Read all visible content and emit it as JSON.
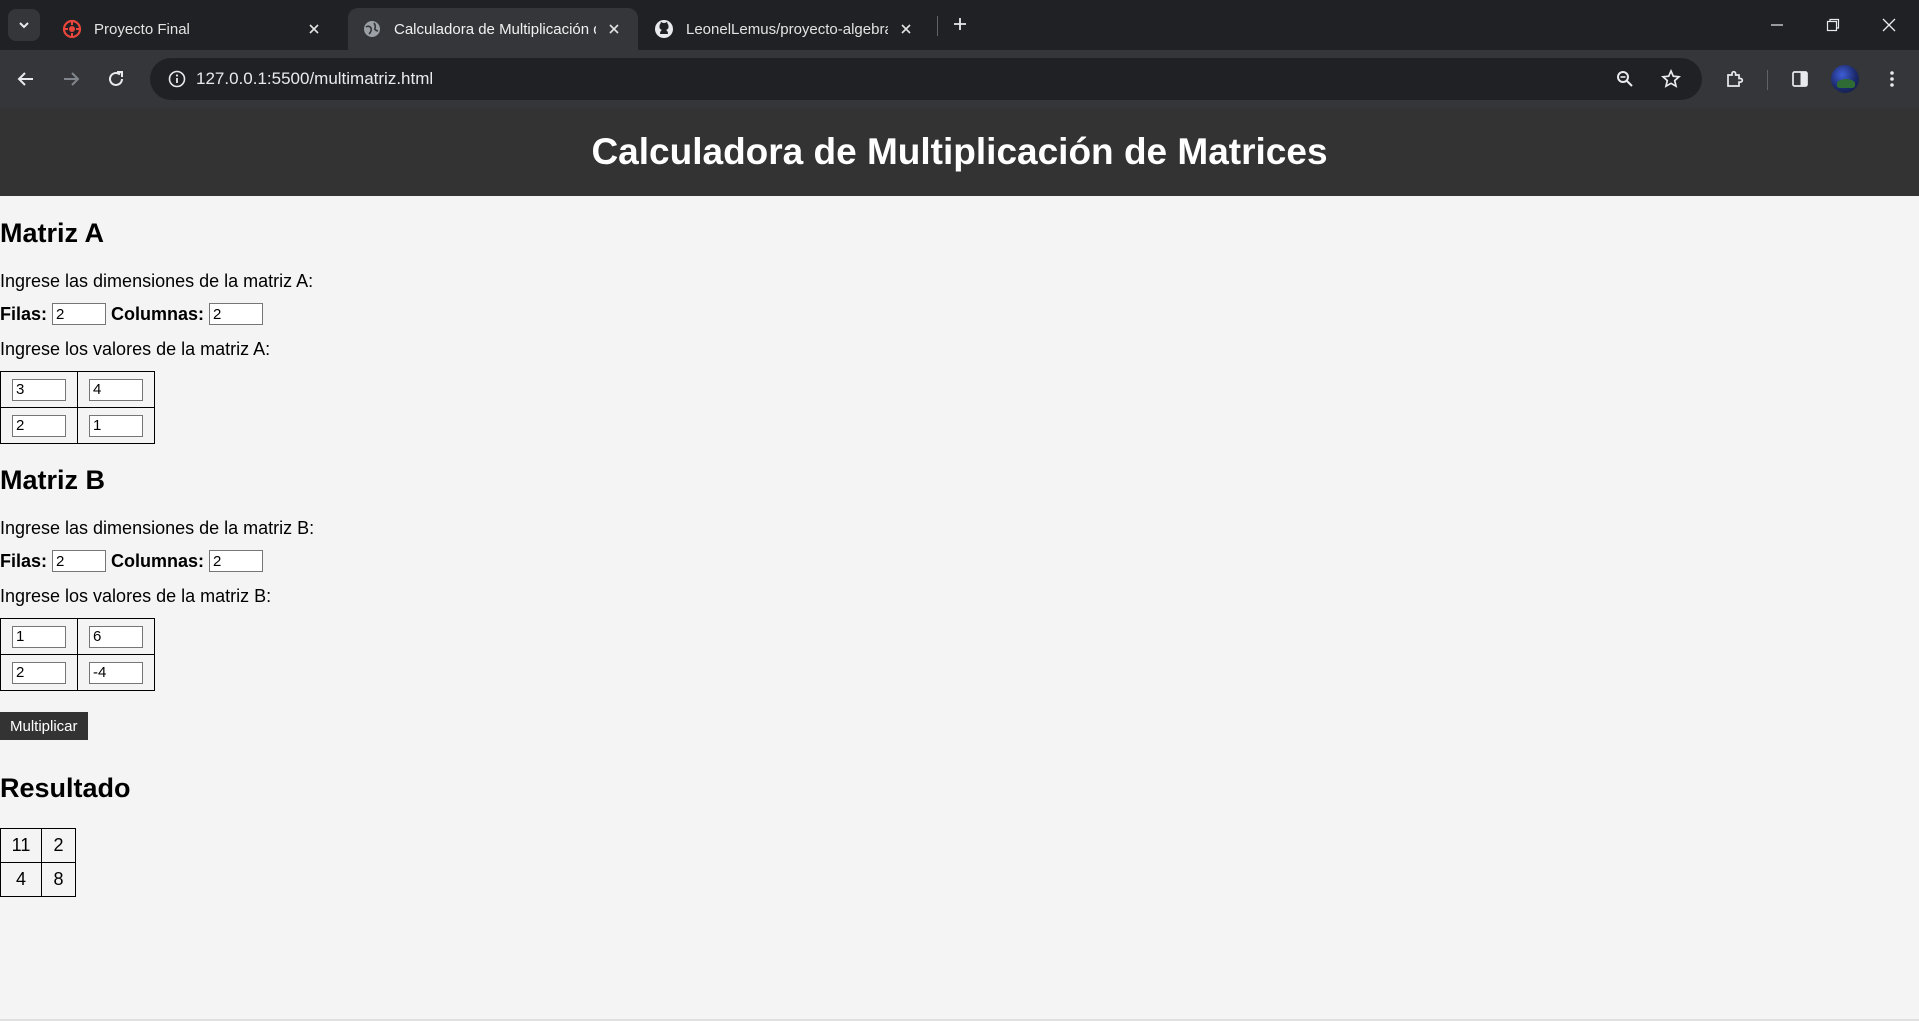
{
  "browser": {
    "tabs": [
      {
        "title": "Proyecto Final",
        "icon": "red-globe-icon"
      },
      {
        "title": "Calculadora de Multiplicación de Matrices",
        "icon": "globe-icon",
        "active": true
      },
      {
        "title": "LeonelLemus/proyecto-algebra",
        "icon": "github-icon"
      }
    ],
    "url": "127.0.0.1:5500/multimatriz.html"
  },
  "page": {
    "header": "Calculadora de Multiplicación de Matrices",
    "matrix_a": {
      "title": "Matriz A",
      "dims_prompt": "Ingrese las dimensiones de la matriz A:",
      "rows_label": "Filas:",
      "rows_value": "2",
      "cols_label": "Columnas:",
      "cols_value": "2",
      "values_prompt": "Ingrese los valores de la matriz A:",
      "values": [
        [
          "3",
          "4"
        ],
        [
          "2",
          "1"
        ]
      ]
    },
    "matrix_b": {
      "title": "Matriz B",
      "dims_prompt": "Ingrese las dimensiones de la matriz B:",
      "rows_label": "Filas:",
      "rows_value": "2",
      "cols_label": "Columnas:",
      "cols_value": "2",
      "values_prompt": "Ingrese los valores de la matriz B:",
      "values": [
        [
          "1",
          "6"
        ],
        [
          "2",
          "-4"
        ]
      ]
    },
    "multiply_button": "Multiplicar",
    "result": {
      "title": "Resultado",
      "values": [
        [
          "11",
          "2"
        ],
        [
          "4",
          "8"
        ]
      ]
    }
  },
  "colors": {
    "header_bg": "#333333",
    "page_bg": "#f4f4f4",
    "chrome_dark": "#202124",
    "chrome_toolbar": "#35363a"
  }
}
